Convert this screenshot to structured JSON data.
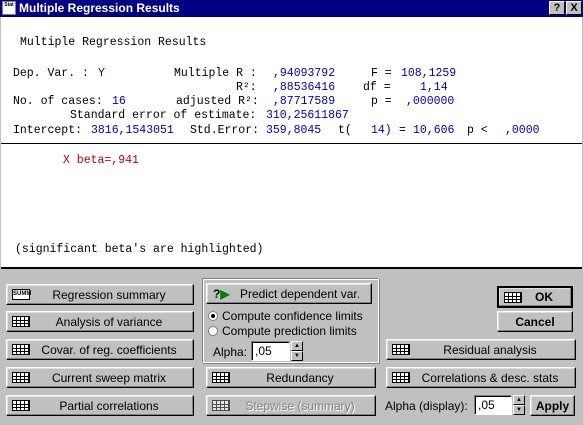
{
  "window": {
    "title": "Multiple Regression Results",
    "app_icon_text": "Stat",
    "help_button": "?",
    "close_button": "X"
  },
  "results": {
    "heading": "Multiple Regression Results",
    "dep_var_label": "Dep. Var. :",
    "dep_var_value": "Y",
    "multiple_r_label": "Multiple R :",
    "multiple_r_value": ",94093792",
    "f_label": "F =",
    "f_value": "108,1259",
    "r2_label": "R²:",
    "r2_value": ",88536416",
    "df_label": "df =",
    "df_value": "1,14",
    "cases_label": "No. of cases:",
    "cases_value": "16",
    "adj_r2_label": "adjusted R²:",
    "adj_r2_value": ",87717589",
    "p_label": "p =",
    "p_value": ",000000",
    "se_label": "Standard error of estimate:",
    "se_value": "310,25611867",
    "intercept_label": "Intercept:",
    "intercept_value": "3816,1543051",
    "std_error_label": "Std.Error:",
    "std_error_value": "359,8045",
    "t_label": "t(",
    "t_df": "14)",
    "t_eq": "=",
    "t_value": "10,606",
    "p2_label": "p <",
    "p2_value": ",0000",
    "beta_line": "X beta=,941",
    "footnote": "(significant beta's are highlighted)"
  },
  "buttons": {
    "regression_summary": "Regression summary",
    "analysis_of_variance": "Analysis of variance",
    "covar": "Covar. of reg. coefficients",
    "current_sweep": "Current sweep matrix",
    "partial_correlations": "Partial correlations",
    "predict": "Predict dependent var.",
    "redundancy": "Redundancy",
    "stepwise": "Stepwise (summary)",
    "ok": "OK",
    "cancel": "Cancel",
    "residual": "Residual analysis",
    "correlations": "Correlations & desc. stats",
    "apply": "Apply"
  },
  "options": {
    "confidence": "Compute confidence limits",
    "prediction": "Compute prediction limits",
    "confidence_selected": true,
    "alpha_label": "Alpha:",
    "alpha_value": ",05",
    "alpha_display_label": "Alpha (display):",
    "alpha_display_value": ",05"
  }
}
